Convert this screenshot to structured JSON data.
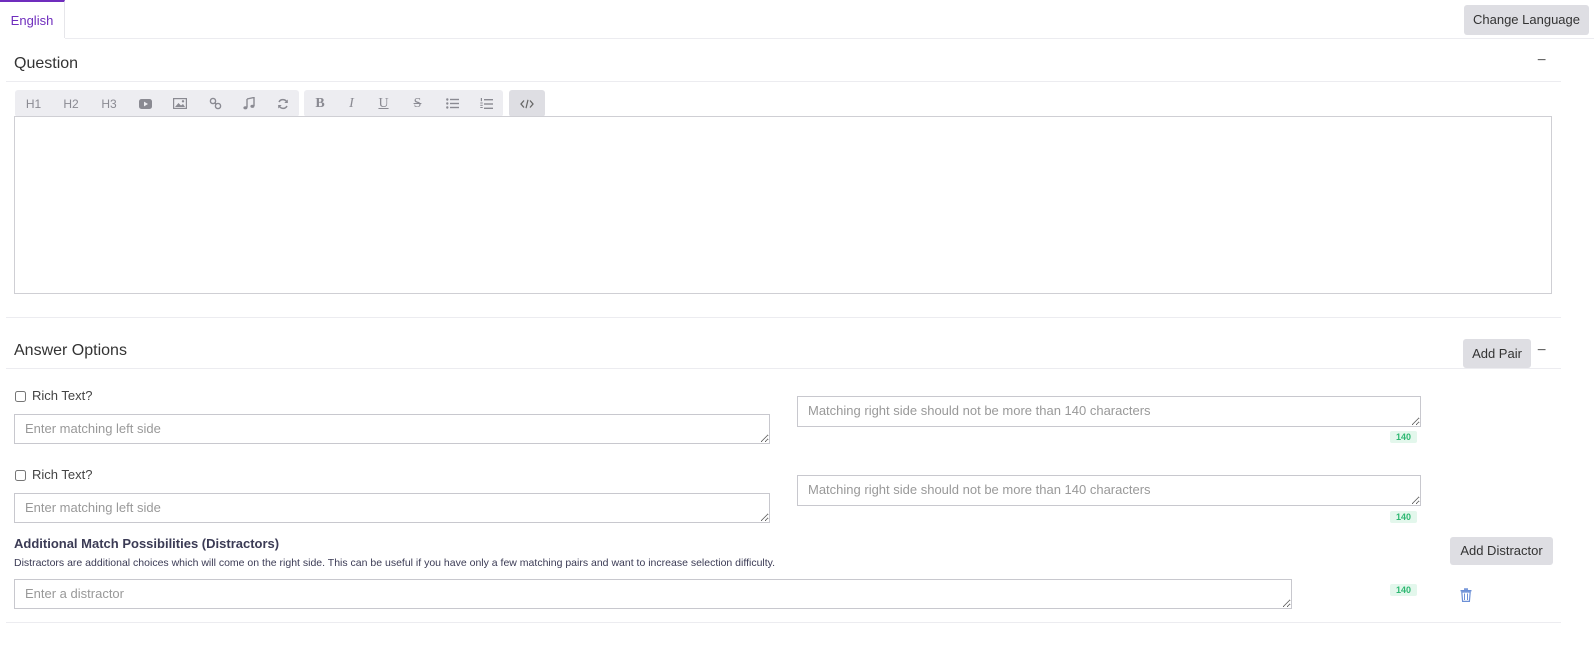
{
  "tabs": {
    "active_label": "English"
  },
  "header": {
    "change_language_label": "Change Language"
  },
  "question": {
    "title": "Question",
    "collapse_label": "−",
    "toolbar": {
      "h1": "H1",
      "h2": "H2",
      "h3": "H3",
      "bold": "B",
      "italic": "I",
      "underline": "U",
      "strike": "S"
    }
  },
  "answers": {
    "title": "Answer Options",
    "add_pair_label": "Add Pair",
    "collapse_label": "−",
    "pairs": [
      {
        "rich_text_label": "Rich Text?",
        "left_placeholder": "Enter matching left side",
        "right_placeholder": "Matching right side should not be more than 140 characters",
        "counter": "140"
      },
      {
        "rich_text_label": "Rich Text?",
        "left_placeholder": "Enter matching left side",
        "right_placeholder": "Matching right side should not be more than 140 characters",
        "counter": "140"
      }
    ],
    "distractors": {
      "heading": "Additional Match Possibilities (Distractors)",
      "description": "Distractors are additional choices which will come on the right side. This can be useful if you have only a few matching pairs and want to increase selection difficulty.",
      "add_label": "Add Distractor",
      "placeholder": "Enter a distractor",
      "counter": "140"
    }
  },
  "colors": {
    "accent": "#6f2dbd",
    "badge_green": "#2eb872",
    "button_bg": "#dedee3"
  }
}
